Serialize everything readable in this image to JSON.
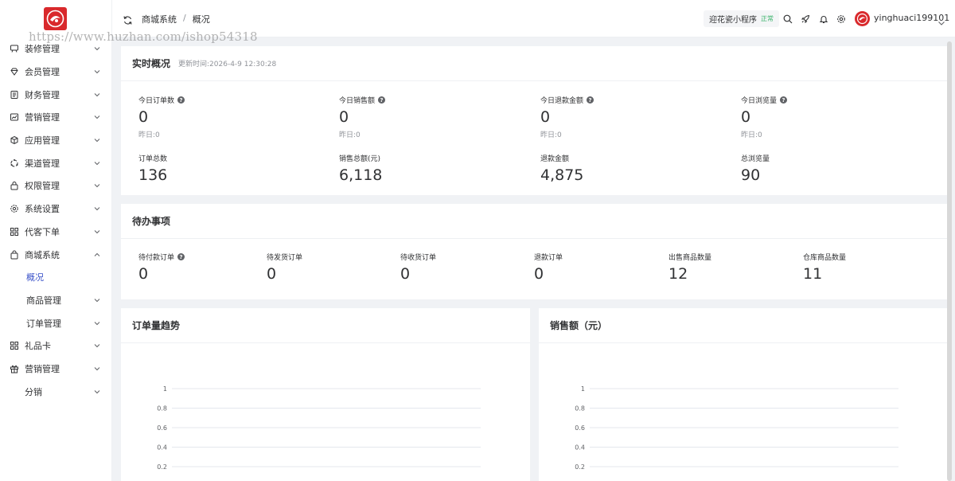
{
  "watermark": "https://www.huzhan.com/ishop54318",
  "colors": {
    "accent": "#3a52c9",
    "brand": "#d9292c",
    "status_green": "#3bb36b"
  },
  "sidebar": {
    "items": [
      {
        "label": "装修管理",
        "icon": "palette-icon"
      },
      {
        "label": "会员管理",
        "icon": "diamond-icon"
      },
      {
        "label": "财务管理",
        "icon": "finance-icon"
      },
      {
        "label": "营销管理",
        "icon": "chart-icon"
      },
      {
        "label": "应用管理",
        "icon": "cube-icon"
      },
      {
        "label": "渠道管理",
        "icon": "channel-icon"
      },
      {
        "label": "权限管理",
        "icon": "lock-icon"
      },
      {
        "label": "系统设置",
        "icon": "gear-icon"
      },
      {
        "label": "代客下单",
        "icon": "grid-icon"
      },
      {
        "label": "商城系统",
        "icon": "bag-icon"
      },
      {
        "label": "概况"
      },
      {
        "label": "商品管理"
      },
      {
        "label": "订单管理"
      },
      {
        "label": "礼品卡",
        "icon": "grid-icon"
      },
      {
        "label": "营销管理",
        "icon": "gift-icon"
      },
      {
        "label": "分销"
      }
    ]
  },
  "header": {
    "breadcrumb": [
      "商城系统",
      "概况"
    ],
    "breadcrumb_sep": "/",
    "app_name": "迎花瓷小程序",
    "app_status": "正常",
    "username": "yinghuaci199101"
  },
  "realtime": {
    "title": "实时概况",
    "updated": "更新时间:2026-4-9 12:30:28",
    "today": [
      {
        "label": "今日订单数",
        "value": "0",
        "yesterday": "昨日:0"
      },
      {
        "label": "今日销售额",
        "value": "0",
        "yesterday": "昨日:0"
      },
      {
        "label": "今日退款金额",
        "value": "0",
        "yesterday": "昨日:0"
      },
      {
        "label": "今日浏览量",
        "value": "0",
        "yesterday": "昨日:0"
      }
    ],
    "totals": [
      {
        "label": "订单总数",
        "value": "136"
      },
      {
        "label": "销售总额(元)",
        "value": "6,118"
      },
      {
        "label": "退款金额",
        "value": "4,875"
      },
      {
        "label": "总浏览量",
        "value": "90"
      }
    ]
  },
  "todo": {
    "title": "待办事项",
    "items": [
      {
        "label": "待付款订单",
        "value": "0"
      },
      {
        "label": "待发货订单",
        "value": "0"
      },
      {
        "label": "待收货订单",
        "value": "0"
      },
      {
        "label": "退款订单",
        "value": "0"
      },
      {
        "label": "出售商品数量",
        "value": "12"
      },
      {
        "label": "仓库商品数量",
        "value": "11"
      }
    ]
  },
  "chart_data": [
    {
      "type": "line",
      "title": "订单量趋势",
      "xlabel": "",
      "ylabel": "",
      "ylim": [
        0,
        1
      ],
      "yticks": [
        "1",
        "0.8",
        "0.6",
        "0.4",
        "0.2"
      ],
      "series": [],
      "grid": true
    },
    {
      "type": "line",
      "title": "销售额（元）",
      "xlabel": "",
      "ylabel": "",
      "ylim": [
        0,
        1
      ],
      "yticks": [
        "1",
        "0.8",
        "0.6",
        "0.4",
        "0.2"
      ],
      "series": [],
      "grid": true
    }
  ]
}
